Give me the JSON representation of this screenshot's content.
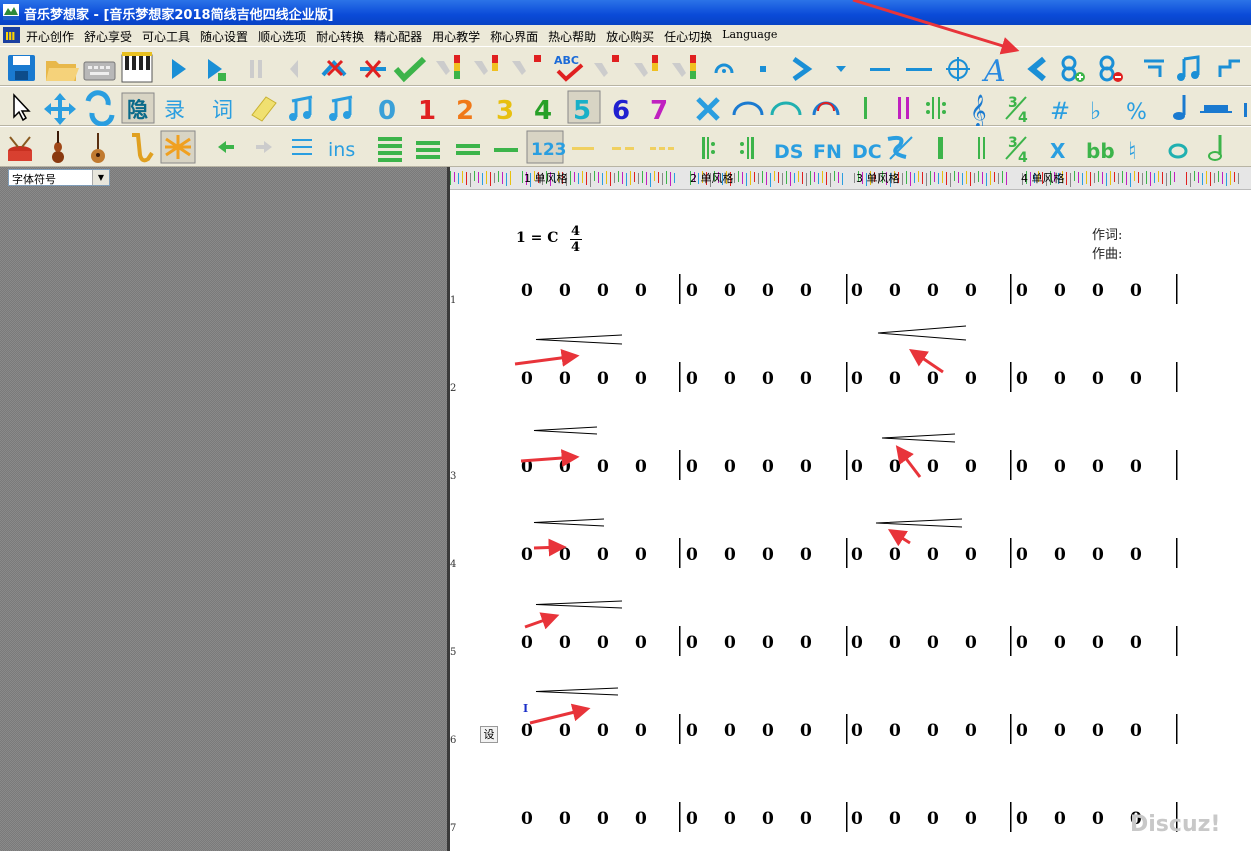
{
  "window": {
    "title": "音乐梦想家 - [音乐梦想家2018简线吉他四线企业版]"
  },
  "menu": {
    "items": [
      "开心创作",
      "舒心享受",
      "可心工具",
      "随心设置",
      "顺心选项",
      "耐心转换",
      "精心配器",
      "用心教学",
      "称心界面",
      "热心帮助",
      "放心购买",
      "任心切换",
      "Language"
    ]
  },
  "toolbar2": {
    "hide_label": "隐",
    "record_label": "录",
    "lyric_label": "词",
    "digits": [
      "0",
      "1",
      "2",
      "3",
      "4",
      "5",
      "6",
      "7"
    ],
    "digit_colors": [
      "#3aa0d8",
      "#e02020",
      "#f07818",
      "#e8c010",
      "#28a028",
      "#18b0c8",
      "#2020d0",
      "#c020c0"
    ],
    "fraction_top": "3",
    "fraction_bottom": "4"
  },
  "toolbar3": {
    "ins_label": "ins",
    "numbered_label": "123",
    "ds_label": "DS",
    "fn_label": "FN",
    "dc_label": "DC",
    "fraction_top": "3",
    "fraction_bottom": "4",
    "x_label": "X",
    "bb_label": "bb"
  },
  "toolbar1": {
    "spell_label": "ABC"
  },
  "left_panel": {
    "font_select_value": "字体符号"
  },
  "ruler": {
    "tracks": [
      "1 单风格",
      "2 单风格",
      "3 单风格",
      "4 单风格"
    ]
  },
  "score": {
    "key": "1 = C",
    "time_signature": {
      "top": "4",
      "bottom": "4"
    },
    "lyricist_label": "作词:",
    "composer_label": "作曲:",
    "rows": [
      "1",
      "2",
      "3",
      "4",
      "5",
      "6",
      "7"
    ],
    "note_value": "0",
    "notes_per_measure": 4,
    "measures_per_row": 4,
    "set_button_label": "设",
    "cursor": "I"
  },
  "watermark": "Discuz!",
  "colors": {
    "title_bar": "#0a4ad8",
    "annotation_arrow": "#e8343a",
    "toolbar_icon_blue": "#1a8fd6",
    "toolbar_icon_green": "#3cb44a"
  }
}
